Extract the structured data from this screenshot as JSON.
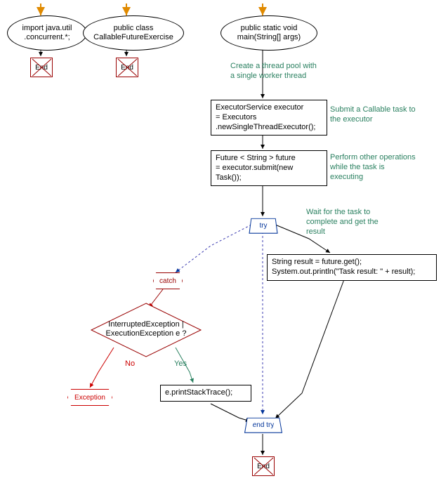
{
  "ellipses": {
    "import": "import java.util\n.concurrent.*;",
    "class": "public class\nCallableFutureExercise",
    "main": "public static void\nmain(String[] args)"
  },
  "comments": {
    "c1": "Create a thread pool with\na single worker thread",
    "c2": "Submit a Callable task to\nthe executor",
    "c3": "Perform other operations\nwhile the task is\nexecuting",
    "c4": "Wait for the task to\ncomplete and get the\nresult"
  },
  "rects": {
    "r1": "ExecutorService executor\n= Executors\n.newSingleThreadExecutor();",
    "r2": "Future < String > future\n= executor.submit(new\nTask());",
    "r3": "String result = future.get();\nSystem.out.println(\"Task result: \" + result);",
    "r4": "e.printStackTrace();"
  },
  "try_label": "try",
  "endtry_label": "end try",
  "catch_label": "catch",
  "diamond": "InterruptedException |\nExecutionException e ?",
  "exception_label": "Exception",
  "yes_label": "Yes",
  "no_label": "No",
  "end_label": "End",
  "chart_data": null
}
